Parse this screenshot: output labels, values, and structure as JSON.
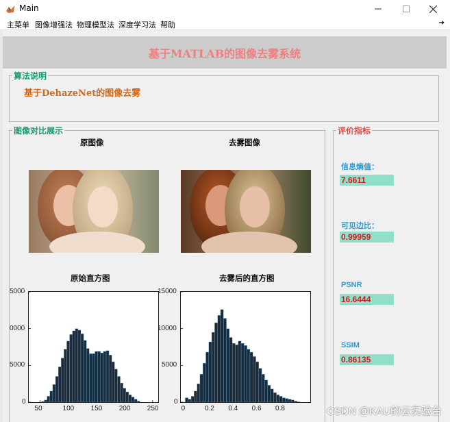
{
  "window": {
    "title": "Main",
    "minimize_icon": "minimize-icon",
    "maximize_icon": "maximize-icon",
    "close_icon": "close-icon"
  },
  "menu": {
    "items": [
      "主菜单",
      "图像增强法",
      "物理模型法",
      "深度学习法",
      "帮助"
    ],
    "overflow": "➔"
  },
  "banner": {
    "title": "基于MATLAB的图像去雾系统"
  },
  "algorithm": {
    "legend": "算法说明",
    "text": "基于DehazeNet的图像去雾"
  },
  "compare": {
    "legend": "图像对比展示",
    "original_title": "原图像",
    "dehazed_title": "去雾图像",
    "orig_hist_title": "原始直方图",
    "dehazed_hist_title": "去雾后的直方图"
  },
  "metrics": {
    "legend": "评价指标",
    "entropy_label": "信息熵值：",
    "entropy_value": "7.6611",
    "edge_label": "可见边比：",
    "edge_value": "0.99959",
    "psnr_label": "PSNR",
    "psnr_value": "16.6444",
    "ssim_label": "SSIM",
    "ssim_value": "0.86135"
  },
  "colors": {
    "banner_bg": "#cccccc",
    "banner_text": "#f08080",
    "legend_green": "#1a9b6c",
    "legend_red": "#e34a4a",
    "metric_bg": "#8fdfc9",
    "metric_value": "#d81b1b",
    "metric_label": "#2a9bd8",
    "bar_fill": "#1b2b3a",
    "bar_edge": "#6fb0d8"
  },
  "watermark": "CSDN @KAU的云实验台",
  "chart_data": [
    {
      "type": "bar",
      "title": "原始直方图",
      "xlim": [
        30,
        260
      ],
      "ylim": [
        0,
        15000
      ],
      "xticks": [
        50,
        100,
        150,
        200,
        250
      ],
      "yticks": [
        0,
        5000,
        10000,
        15000
      ],
      "ytick_labels": [
        "0",
        "5000",
        "0000",
        "5000"
      ],
      "x": [
        55,
        60,
        65,
        70,
        75,
        80,
        85,
        90,
        95,
        100,
        105,
        110,
        115,
        120,
        125,
        130,
        135,
        140,
        145,
        150,
        155,
        160,
        165,
        170,
        175,
        180,
        185,
        190,
        195,
        200,
        205,
        210,
        215,
        220,
        225
      ],
      "values": [
        100,
        300,
        800,
        1500,
        2400,
        3500,
        4800,
        6000,
        7200,
        8300,
        9200,
        9700,
        10000,
        9800,
        9300,
        8400,
        7300,
        6600,
        6600,
        6900,
        6900,
        6700,
        6900,
        7000,
        6400,
        5500,
        4500,
        3500,
        2600,
        1900,
        1400,
        1000,
        700,
        400,
        150
      ]
    },
    {
      "type": "bar",
      "title": "去雾后的直方图",
      "xlim": [
        -0.05,
        1.05
      ],
      "ylim": [
        0,
        15000
      ],
      "xticks": [
        0,
        0.2,
        0.4,
        0.6,
        0.8
      ],
      "yticks": [
        0,
        5000,
        10000,
        15000
      ],
      "ytick_labels": [
        "0",
        "5000",
        "10000",
        "15000"
      ],
      "x": [
        0.0,
        0.025,
        0.05,
        0.075,
        0.1,
        0.125,
        0.15,
        0.175,
        0.2,
        0.225,
        0.25,
        0.275,
        0.3,
        0.325,
        0.35,
        0.375,
        0.4,
        0.425,
        0.45,
        0.475,
        0.5,
        0.525,
        0.55,
        0.575,
        0.6,
        0.625,
        0.65,
        0.675,
        0.7,
        0.725,
        0.75,
        0.775,
        0.8,
        0.825,
        0.85,
        0.875,
        0.9,
        0.925,
        0.95
      ],
      "values": [
        600,
        400,
        800,
        1500,
        2500,
        3800,
        5300,
        6800,
        8200,
        9500,
        10800,
        11800,
        12600,
        11400,
        10000,
        8800,
        8000,
        7800,
        8300,
        8000,
        7700,
        7200,
        6800,
        6200,
        5500,
        4600,
        3800,
        3000,
        2300,
        1800,
        1300,
        1000,
        800,
        600,
        500,
        400,
        300,
        150,
        50
      ]
    }
  ]
}
